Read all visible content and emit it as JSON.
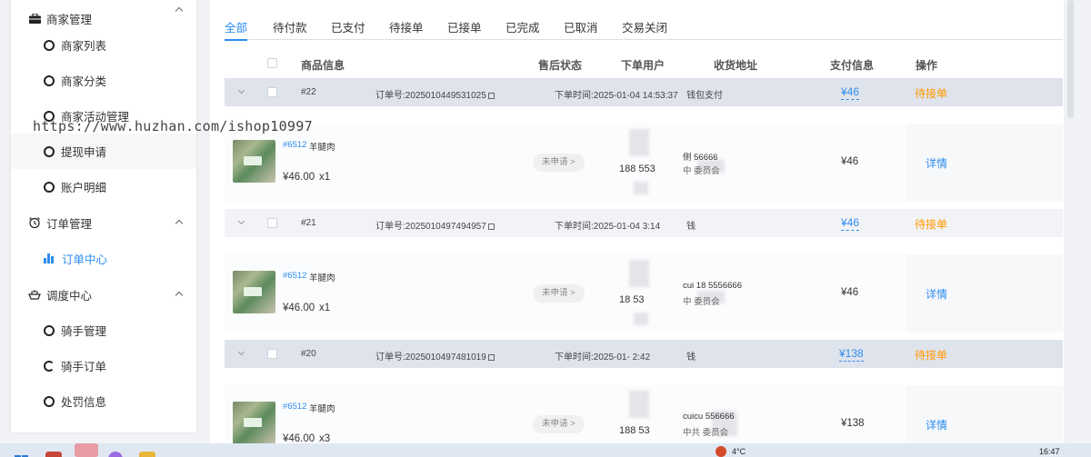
{
  "sidebar": {
    "groups": [
      {
        "label": "商家管理",
        "icon": "briefcase-icon",
        "items": [
          {
            "label": "商家列表"
          },
          {
            "label": "商家分类"
          },
          {
            "label": "商家活动管理"
          },
          {
            "label": "提现申请"
          },
          {
            "label": "账户明细"
          }
        ]
      },
      {
        "label": "订单管理",
        "icon": "alarm-clock-icon",
        "items": [
          {
            "label": "订单中心",
            "active": true
          }
        ]
      },
      {
        "label": "调度中心",
        "icon": "dispatch-icon",
        "items": [
          {
            "label": "骑手管理"
          },
          {
            "label": "骑手订单"
          },
          {
            "label": "处罚信息"
          }
        ]
      }
    ],
    "watermark": "https://www.huzhan.com/ishop10997"
  },
  "tabs": [
    "全部",
    "待付款",
    "已支付",
    "待接单",
    "已接单",
    "已完成",
    "已取消",
    "交易关闭"
  ],
  "active_tab": "全部",
  "columns": {
    "product": "商品信息",
    "after_sale": "售后状态",
    "user": "下单用户",
    "address": "收货地址",
    "payment": "支付信息",
    "action": "操作"
  },
  "orders": [
    {
      "no": "#22",
      "order_no": "订单号:2025010449531025",
      "time": "下单时间:2025-01-04 14:53:37",
      "pay_method": "钱包支付",
      "pay_amount": "¥46",
      "status": "待接单",
      "product_id": "#6512",
      "product_name": "羊腿肉",
      "price": "¥46.00",
      "qty": "x1",
      "after_sale": "未申请 >",
      "phone": "188 553",
      "addr1": "侧 56666",
      "addr2": "中 委员会",
      "paid": "¥46",
      "detail": "详情"
    },
    {
      "no": "#21",
      "order_no": "订单号:2025010497494957",
      "time": "下单时间:2025-01-04 3:14",
      "pay_method": "钱",
      "pay_amount": "¥46",
      "status": "待接单",
      "product_id": "#6512",
      "product_name": "羊腿肉",
      "price": "¥46.00",
      "qty": "x1",
      "after_sale": "未申请 >",
      "phone": "18 53",
      "addr1": "cui 18 5556666",
      "addr2": "中 委员会",
      "paid": "¥46",
      "detail": "详情"
    },
    {
      "no": "#20",
      "order_no": "订单号:2025010497481019",
      "time": "下单时间:2025-01- 2:42",
      "pay_method": "钱",
      "pay_amount": "¥138",
      "status": "待接单",
      "product_id": "#6512",
      "product_name": "羊腿肉",
      "price": "¥46.00",
      "qty": "x3",
      "after_sale": "未申请 >",
      "phone": "188 53",
      "addr1": "cuicu 556666",
      "addr2": "中共 委员会",
      "paid": "¥138",
      "detail": "详情"
    }
  ],
  "taskbar": {
    "weather": "4°C",
    "time": "16:47"
  },
  "colors": {
    "accent": "#2d8cf0",
    "pending": "#ff9900",
    "selected_row": "#dfe3ec"
  }
}
